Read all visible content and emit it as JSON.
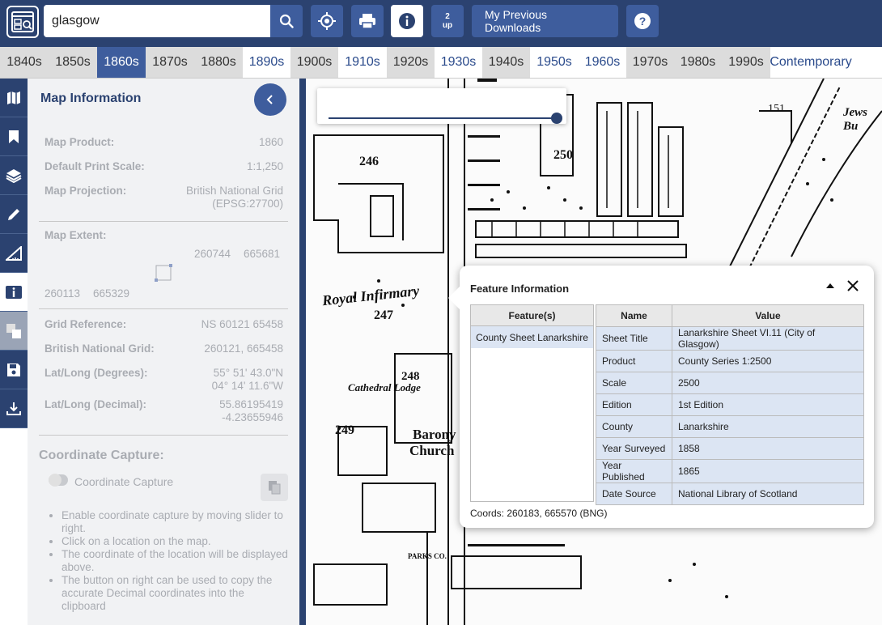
{
  "search": {
    "value": "glasgow"
  },
  "toolbar": {
    "twoup_top": "2",
    "twoup_bottom": "up",
    "downloads_label": "My Previous Downloads"
  },
  "decades": [
    "1840s",
    "1850s",
    "1860s",
    "1870s",
    "1880s",
    "1890s",
    "1900s",
    "1910s",
    "1920s",
    "1930s",
    "1940s",
    "1950s",
    "1960s",
    "1970s",
    "1980s",
    "1990s",
    "Contemporary"
  ],
  "active_decade": "1860s",
  "panel": {
    "title": "Map Information",
    "map_product_label": "Map Product:",
    "map_product": "1860",
    "print_scale_label": "Default Print Scale:",
    "print_scale": "1:1,250",
    "projection_label": "Map Projection:",
    "projection_line1": "British National Grid",
    "projection_line2": "(EPSG:27700)",
    "extent_label": "Map Extent:",
    "extent_ne_x": "260744",
    "extent_ne_y": "665681",
    "extent_sw_x": "260113",
    "extent_sw_y": "665329",
    "grid_ref_label": "Grid Reference:",
    "grid_ref": "NS 60121 65458",
    "bng_label": "British National Grid:",
    "bng": "260121, 665458",
    "latlong_deg_label": "Lat/Long (Degrees):",
    "lat_deg": "55° 51' 43.0\"N",
    "long_deg": "04° 14' 11.6\"W",
    "latlong_dec_label": "Lat/Long (Decimal):",
    "lat_dec": "55.86195419",
    "long_dec": "-4.23655946",
    "coord_capture_title": "Coordinate Capture:",
    "coord_capture_toggle": "Coordinate Capture",
    "instructions": [
      "Enable coordinate capture by moving slider to right.",
      "Click on a location on the map.",
      "The coordinate of the location will be displayed above.",
      "The button on right can be used to copy the accurate Decimal coordinates into the clipboard"
    ]
  },
  "map_labels": {
    "royal_infirmary": "Royal Infirmary",
    "cathedral_lodge": "Cathedral Lodge",
    "barony_church_1": "Barony",
    "barony_church_2": "Church",
    "n246": "246",
    "n247": "247",
    "n248": "248",
    "n249": "249",
    "n250": "250",
    "n151": "151",
    "parks_co": "PARKS CO.",
    "jews": "Jews Bu"
  },
  "opacity": {
    "value": 1.0
  },
  "popup": {
    "title": "Feature Information",
    "features_header": "Feature(s)",
    "feature_item": "County Sheet Lanarkshire",
    "name_header": "Name",
    "value_header": "Value",
    "rows": [
      {
        "name": "Sheet Title",
        "value": "Lanarkshire Sheet VI.11 (City of Glasgow)"
      },
      {
        "name": "Product",
        "value": "County Series 1:2500"
      },
      {
        "name": "Scale",
        "value": "2500"
      },
      {
        "name": "Edition",
        "value": "1st Edition"
      },
      {
        "name": "County",
        "value": "Lanarkshire"
      },
      {
        "name": "Year Surveyed",
        "value": "1858"
      },
      {
        "name": "Year Published",
        "value": "1865"
      },
      {
        "name": "Date Source",
        "value": "National Library of Scotland"
      }
    ],
    "coords": "Coords: 260183, 665570 (BNG)"
  },
  "colors": {
    "brand": "#2b4270",
    "button": "#3e5d9d",
    "highlight": "#dce5f3"
  }
}
